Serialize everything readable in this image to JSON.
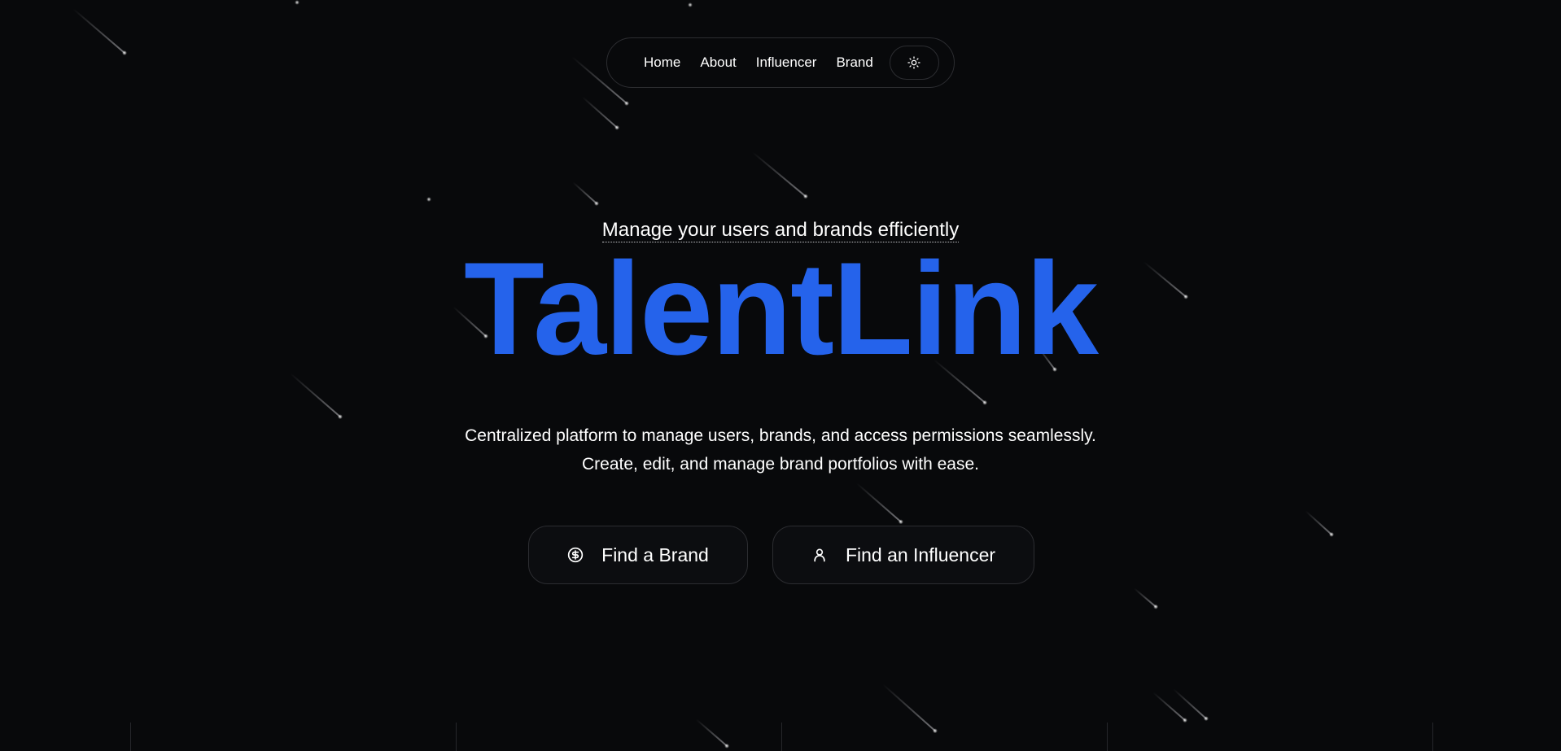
{
  "nav": {
    "links": [
      "Home",
      "About",
      "Influencer",
      "Brand"
    ],
    "theme_toggle_icon": "sun-icon"
  },
  "hero": {
    "tagline": "Manage your users and brands efficiently",
    "title": "TalentLink",
    "description_lines": [
      "Centralized platform to manage users, brands, and access permissions seamlessly.",
      "Create, edit, and manage brand portfolios with ease."
    ]
  },
  "actions": {
    "find_brand": {
      "label": "Find a Brand",
      "icon": "dollar-circle-icon"
    },
    "find_influencer": {
      "label": "Find an Influencer",
      "icon": "user-icon"
    }
  },
  "colors": {
    "background": "#08090b",
    "accent": "#2563eb",
    "border": "#2c2d31"
  }
}
